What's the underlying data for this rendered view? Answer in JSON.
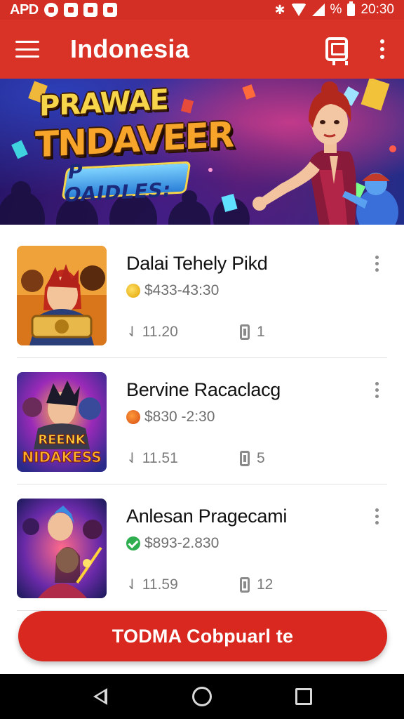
{
  "status_bar": {
    "carrier": "APD",
    "battery_text": "%",
    "time": "20:30",
    "icons": [
      "notification-icon",
      "gmail-icon",
      "calendar-icon",
      "photo-icon",
      "bluetooth-icon",
      "wifi-icon",
      "signal-icon",
      "battery-icon"
    ]
  },
  "app_bar": {
    "title": "Indonesia",
    "icons": [
      "menu-icon",
      "store-icon",
      "more-icon"
    ]
  },
  "banner": {
    "title_line1": "PRAWAE",
    "title_line2": "TNDAVEER",
    "badge": "P OAIDLES:"
  },
  "items": [
    {
      "title": "Dalai Tehely Pikd",
      "price": "$433-43:30",
      "coin_icon": "gold-coin-icon",
      "downloads": "11.20",
      "devices": "1"
    },
    {
      "title": "Bervine Racaclacg",
      "price": "$830 -2:30",
      "coin_icon": "orange-coin-icon",
      "downloads": "11.51",
      "devices": "5"
    },
    {
      "title": "Anlesan Pragecami",
      "price": "$893-2.830",
      "coin_icon": "check-icon",
      "downloads": "11.59",
      "devices": "12"
    }
  ],
  "thumb_captions": [
    "",
    "REENK NIDAKESS",
    ""
  ],
  "cta": {
    "label": "TODMA Cobpuarl te"
  },
  "colors": {
    "primary": "#d93226",
    "cta": "#d9281f",
    "nav_bg": "#000000"
  }
}
